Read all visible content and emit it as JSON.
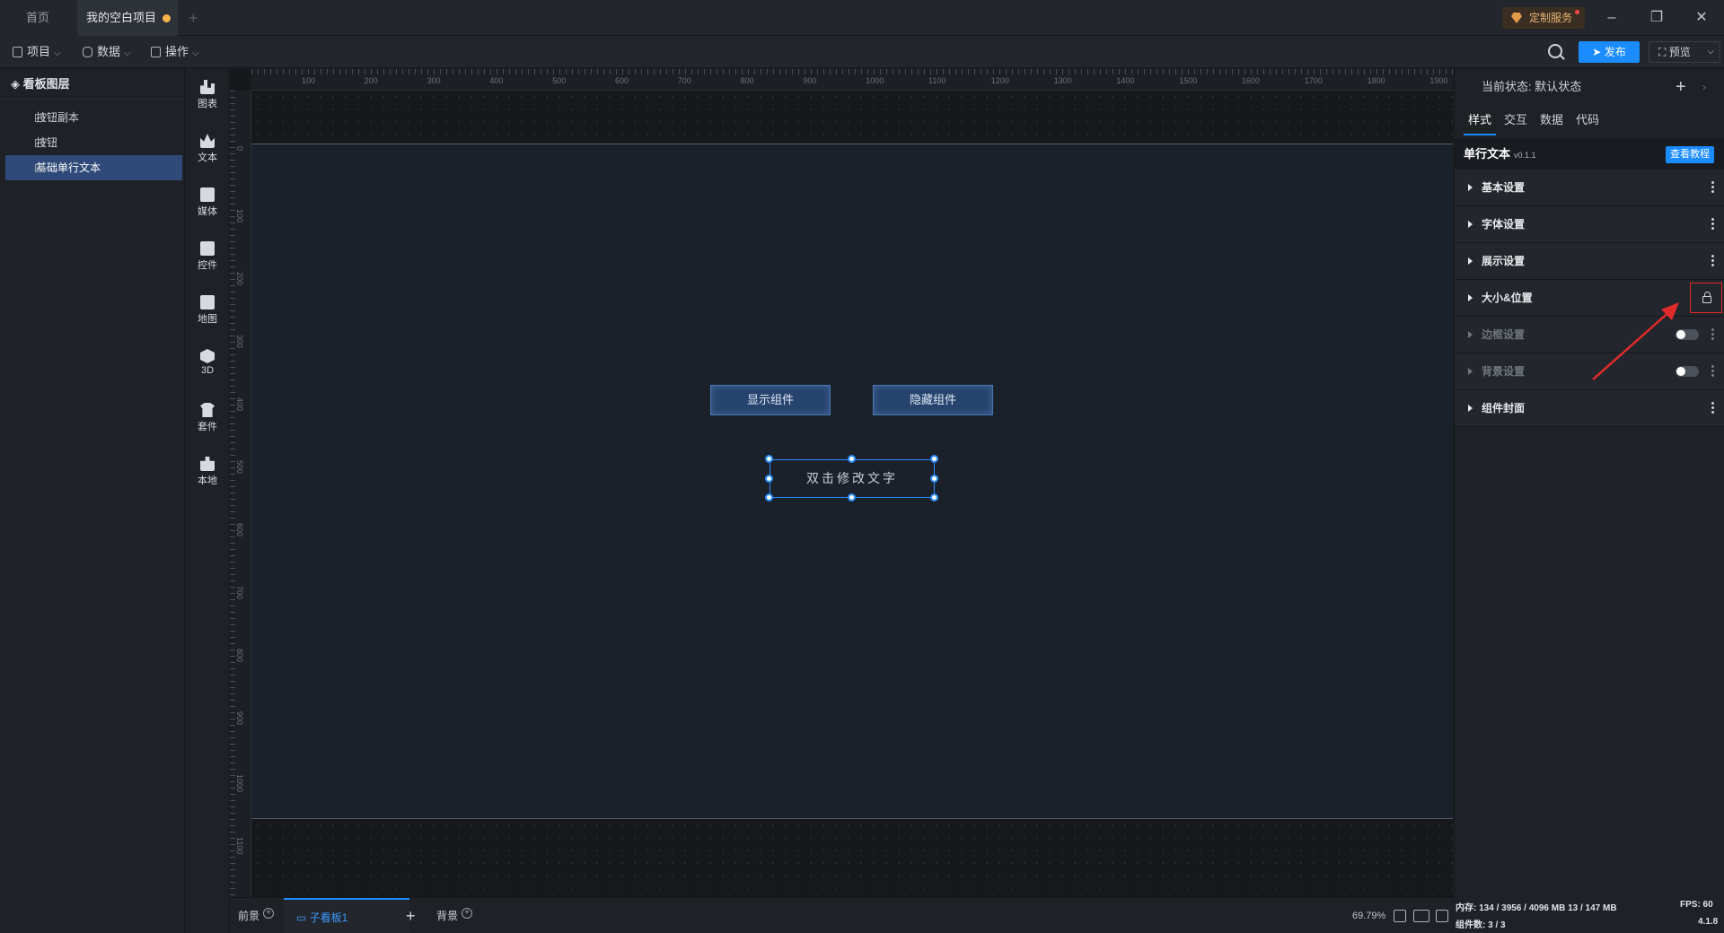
{
  "tabs": {
    "home": "首页",
    "project": "我的空白项目"
  },
  "custom_service": "定制服务",
  "toolbar": {
    "project": "项目",
    "data": "数据",
    "ops": "操作",
    "publish": "发布",
    "preview": "预览"
  },
  "layers": {
    "title": "看板图层",
    "items": [
      {
        "label": "按钮副本"
      },
      {
        "label": "按钮"
      },
      {
        "label": "基础单行文本"
      }
    ]
  },
  "components": [
    "图表",
    "文本",
    "媒体",
    "控件",
    "地图",
    "3D",
    "套件",
    "本地"
  ],
  "ruler": {
    "top": [
      "100",
      "200",
      "300",
      "400",
      "500",
      "600",
      "700",
      "800",
      "900",
      "1000",
      "1100",
      "1200",
      "1300",
      "1400",
      "1500",
      "1600",
      "1700",
      "1800",
      "1900"
    ],
    "left": [
      "0",
      "100",
      "200",
      "300",
      "400",
      "500",
      "600",
      "700",
      "800",
      "900",
      "1000",
      "1100"
    ]
  },
  "canvas": {
    "btn_show": "显示组件",
    "btn_hide": "隐藏组件",
    "text_box": "双击修改文字"
  },
  "bottom": {
    "front": "前景",
    "sub_board": "子看板1",
    "back": "背景",
    "zoom": "69.79%"
  },
  "panel": {
    "state_label": "当前状态:",
    "state_value": "默认状态",
    "tabs": [
      "样式",
      "交互",
      "数据",
      "代码"
    ],
    "comp_name": "单行文本",
    "comp_version": "v0.1.1",
    "tutorial": "查看教程",
    "sections": [
      {
        "label": "基本设置"
      },
      {
        "label": "字体设置"
      },
      {
        "label": "展示设置"
      },
      {
        "label": "大小&位置"
      },
      {
        "label": "边框设置"
      },
      {
        "label": "背景设置"
      },
      {
        "label": "组件封面"
      }
    ]
  },
  "status": {
    "memory": "内存: 134 / 3956 / 4096 MB 13 / 147 MB",
    "fps": "FPS: 60",
    "count": "组件数: 3 / 3",
    "version": "4.1.8"
  },
  "colors": {
    "accent": "#1a8cff",
    "highlight": "#e02b2b",
    "selected_layer": "#2f4a78"
  }
}
